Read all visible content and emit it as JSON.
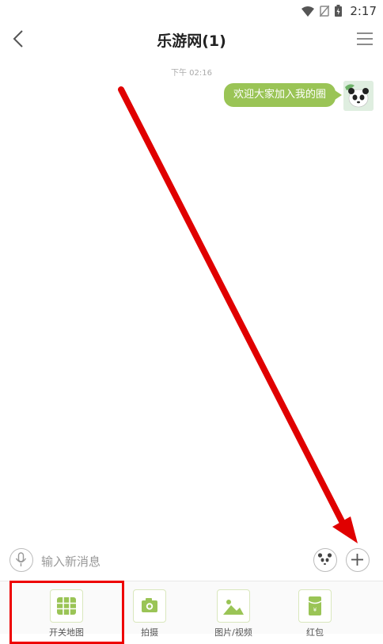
{
  "status_bar": {
    "time": "2:17"
  },
  "header": {
    "title": "乐游网(1)"
  },
  "chat": {
    "timestamp": "下午 02:16",
    "messages": [
      {
        "text": "欢迎大家加入我的圈"
      }
    ]
  },
  "input": {
    "placeholder": "输入新消息",
    "value": ""
  },
  "panel": {
    "items": [
      {
        "label": "开关地图",
        "icon": "grid-icon"
      },
      {
        "label": "拍摄",
        "icon": "camera-icon"
      },
      {
        "label": "图片/视频",
        "icon": "image-icon"
      },
      {
        "label": "红包",
        "icon": "red-packet-icon"
      }
    ]
  },
  "colors": {
    "accent": "#9ac456",
    "annotation": "#e00000"
  }
}
